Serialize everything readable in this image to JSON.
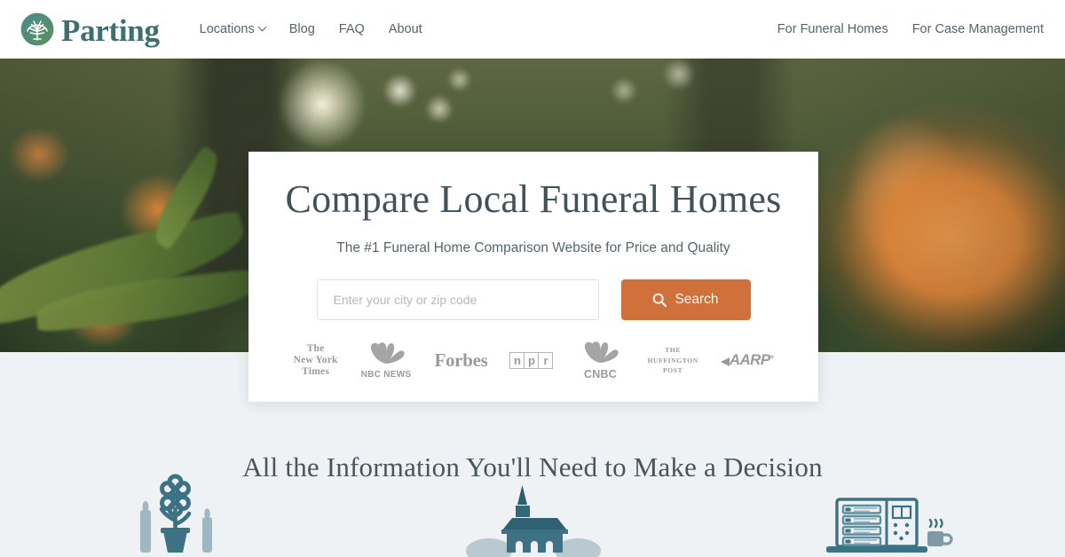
{
  "brand": {
    "name": "Parting",
    "logo_icon": "tree-circle-icon",
    "logo_color_start": "#4a8a8f",
    "logo_color_end": "#5d8f5a"
  },
  "nav": {
    "left_items": [
      {
        "label": "Locations",
        "has_dropdown": true,
        "icon": "chevron-down-icon"
      },
      {
        "label": "Blog",
        "has_dropdown": false
      },
      {
        "label": "FAQ",
        "has_dropdown": false
      },
      {
        "label": "About",
        "has_dropdown": false
      }
    ],
    "right_items": [
      {
        "label": "For Funeral Homes"
      },
      {
        "label": "For Case Management"
      }
    ]
  },
  "hero": {
    "title": "Compare Local Funeral Homes",
    "subtitle": "The #1 Funeral Home Comparison Website for Price and Quality",
    "search": {
      "placeholder": "Enter your city or zip code",
      "value": "",
      "button_label": "Search",
      "button_icon": "search-icon",
      "button_color": "#d0703a"
    },
    "press_logos": [
      {
        "name": "the-new-york-times",
        "line1": "The",
        "line2": "New York",
        "line3": "Times"
      },
      {
        "name": "nbc-news",
        "label": "NBC NEWS"
      },
      {
        "name": "forbes",
        "label": "Forbes"
      },
      {
        "name": "npr",
        "letters": [
          "n",
          "p",
          "r"
        ]
      },
      {
        "name": "cnbc",
        "label": "CNBC"
      },
      {
        "name": "the-huffington-post",
        "line1": "THE",
        "line2": "HUFFINGTON",
        "line3": "POST"
      },
      {
        "name": "aarp",
        "label": "AARP"
      }
    ],
    "background_description": "blurred orange tulip garden with sunlit forest bokeh"
  },
  "info_section": {
    "title": "All the Information You'll Need to Make a Decision",
    "background_color": "#eef2f5",
    "icon_color": "#3d7285",
    "icons": [
      {
        "name": "flower-vase-candles-icon"
      },
      {
        "name": "church-icon"
      },
      {
        "name": "price-comparison-laptop-icon"
      }
    ]
  }
}
